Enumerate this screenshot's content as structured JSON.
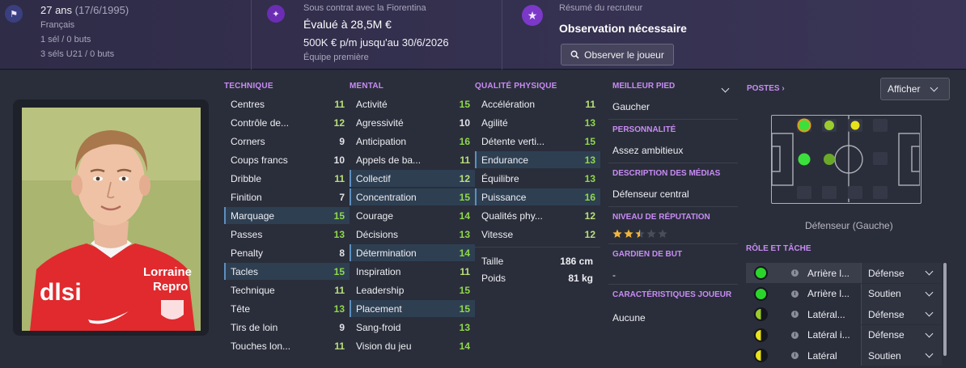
{
  "header": {
    "age": "27 ans",
    "dob": "(17/6/1995)",
    "nationality": "Français",
    "caps": "1 sél / 0 buts",
    "u21_caps": "3 séls U21 / 0 buts",
    "contract_label": "Sous contrat avec la Fiorentina",
    "value": "Évalué à 28,5M €",
    "wage": "500K € p/m jusqu'au 30/6/2026",
    "squad": "Équipe première",
    "scout_label": "Résumé du recruteur",
    "scout_status": "Observation nécessaire",
    "observe_button": "Observer le joueur"
  },
  "technique": {
    "title": "TECHNIQUE",
    "rows": [
      {
        "name": "Centres",
        "value": "11"
      },
      {
        "name": "Contrôle de...",
        "value": "12"
      },
      {
        "name": "Corners",
        "value": "9"
      },
      {
        "name": "Coups francs",
        "value": "10"
      },
      {
        "name": "Dribble",
        "value": "11"
      },
      {
        "name": "Finition",
        "value": "7"
      },
      {
        "name": "Marquage",
        "value": "15"
      },
      {
        "name": "Passes",
        "value": "13"
      },
      {
        "name": "Penalty",
        "value": "8"
      },
      {
        "name": "Tacles",
        "value": "15"
      },
      {
        "name": "Technique",
        "value": "11"
      },
      {
        "name": "Tête",
        "value": "13"
      },
      {
        "name": "Tirs de loin",
        "value": "9"
      },
      {
        "name": "Touches lon...",
        "value": "11"
      }
    ]
  },
  "mental": {
    "title": "MENTAL",
    "rows": [
      {
        "name": "Activité",
        "value": "15"
      },
      {
        "name": "Agressivité",
        "value": "10"
      },
      {
        "name": "Anticipation",
        "value": "16"
      },
      {
        "name": "Appels de ba...",
        "value": "11"
      },
      {
        "name": "Collectif",
        "value": "12"
      },
      {
        "name": "Concentration",
        "value": "15"
      },
      {
        "name": "Courage",
        "value": "14"
      },
      {
        "name": "Décisions",
        "value": "13"
      },
      {
        "name": "Détermination",
        "value": "14"
      },
      {
        "name": "Inspiration",
        "value": "11"
      },
      {
        "name": "Leadership",
        "value": "15"
      },
      {
        "name": "Placement",
        "value": "15"
      },
      {
        "name": "Sang-froid",
        "value": "13"
      },
      {
        "name": "Vision du jeu",
        "value": "14"
      }
    ]
  },
  "physical": {
    "title": "QUALITÉ PHYSIQUE",
    "rows": [
      {
        "name": "Accélération",
        "value": "11"
      },
      {
        "name": "Agilité",
        "value": "13"
      },
      {
        "name": "Détente verti...",
        "value": "15"
      },
      {
        "name": "Endurance",
        "value": "13"
      },
      {
        "name": "Équilibre",
        "value": "13"
      },
      {
        "name": "Puissance",
        "value": "16"
      },
      {
        "name": "Qualités phy...",
        "value": "12"
      },
      {
        "name": "Vitesse",
        "value": "12"
      }
    ],
    "height_label": "Taille",
    "height_value": "186 cm",
    "weight_label": "Poids",
    "weight_value": "81 kg"
  },
  "info": {
    "best_foot_title": "MEILLEUR PIED",
    "best_foot": "Gaucher",
    "personality_title": "PERSONNALITÉ",
    "personality": "Assez ambitieux",
    "media_title": "DESCRIPTION DES MÉDIAS",
    "media": "Défenseur central",
    "reputation_title": "NIVEAU DE RÉPUTATION",
    "reputation_stars": 2.5,
    "reputation_max": 5,
    "goalkeeper_title": "GARDIEN DE BUT",
    "goalkeeper": "-",
    "traits_title": "CARACTÉRISTIQUES JOUEUR",
    "traits": "Aucune"
  },
  "positions": {
    "title": "POSTES",
    "show_button": "Afficher",
    "position_label": "Défenseur (Gauche)"
  },
  "roles": {
    "title": "RÔLE ET TÂCHE",
    "rows": [
      {
        "name": "Arrière l...",
        "duty": "Défense",
        "icon": "full-green-circle"
      },
      {
        "name": "Arrière l...",
        "duty": "Soutien",
        "icon": "full-green-circle"
      },
      {
        "name": "Latéral...",
        "duty": "Défense",
        "icon": "half-green-circle"
      },
      {
        "name": "Latéral i...",
        "duty": "Défense",
        "icon": "half-yellow-circle"
      },
      {
        "name": "Latéral",
        "duty": "Soutien",
        "icon": "half-yellow-circle"
      }
    ]
  },
  "colors": {
    "accent": "#c88cf5",
    "good": "#8fd94b",
    "green_dot": "#2bd62b",
    "yellow_dot": "#e8e21c"
  }
}
